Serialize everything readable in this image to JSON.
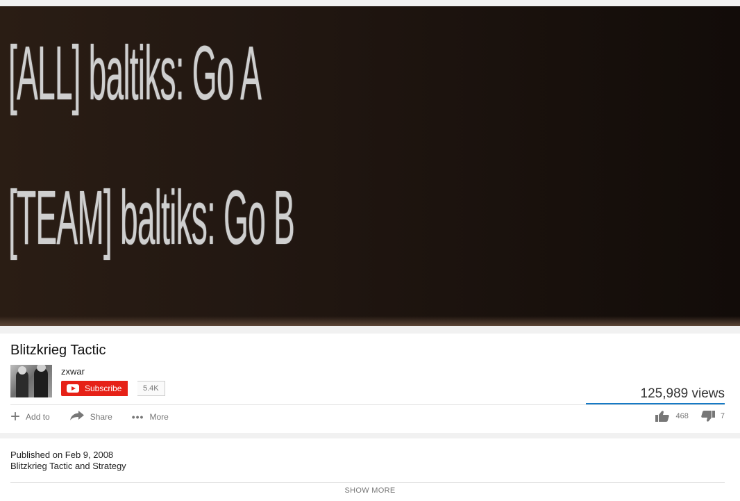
{
  "video": {
    "subtitle_line1": "[ALL] baltiks: Go A",
    "subtitle_line2": "[TEAM] baltiks: Go B"
  },
  "info": {
    "title": "Blitzkrieg Tactic",
    "channel_name": "zxwar",
    "subscribe_label": "Subscribe",
    "subscriber_count": "5.4K",
    "views": "125,989 views",
    "actions": {
      "add_to": "Add to",
      "share": "Share",
      "more": "More"
    },
    "likes": "468",
    "dislikes": "7"
  },
  "description": {
    "published": "Published on Feb 9, 2008",
    "text": "Blitzkrieg Tactic and Strategy",
    "show_more": "SHOW MORE"
  },
  "colors": {
    "subscribe_red": "#e62117",
    "view_bar_blue": "#167ac6"
  },
  "icons": [
    "youtube-logo-icon",
    "plus-icon",
    "share-arrow-icon",
    "more-dots-icon",
    "thumbs-up-icon",
    "thumbs-down-icon"
  ]
}
